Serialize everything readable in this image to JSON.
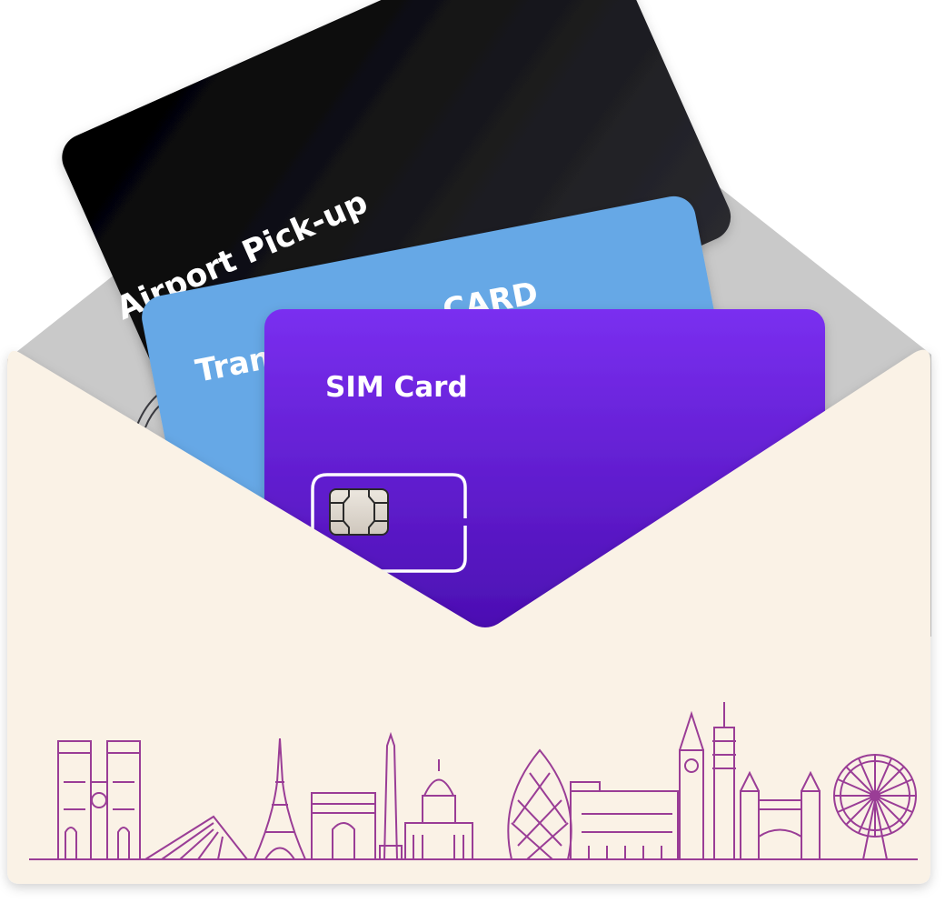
{
  "cards": {
    "airport": {
      "label": "Airport Pick-up",
      "color": "#111114"
    },
    "transport": {
      "label_left": "Tran",
      "label_right": "CARD",
      "color": "#66A8E6"
    },
    "sim": {
      "label": "SIM Card",
      "color_top": "#7A2FF0",
      "color_bottom": "#4208A6"
    }
  },
  "envelope": {
    "back_color": "#C9C9C9",
    "front_color": "#FAF2E6"
  },
  "skyline": {
    "color": "#9A3D96",
    "landmarks": [
      "notre-dame",
      "louvre-pyramid",
      "eiffel-tower",
      "arc-de-triomphe",
      "obelisk",
      "les-invalides",
      "gherkin",
      "palace-of-westminster",
      "big-ben",
      "bt-tower",
      "tower-bridge",
      "london-eye"
    ]
  }
}
